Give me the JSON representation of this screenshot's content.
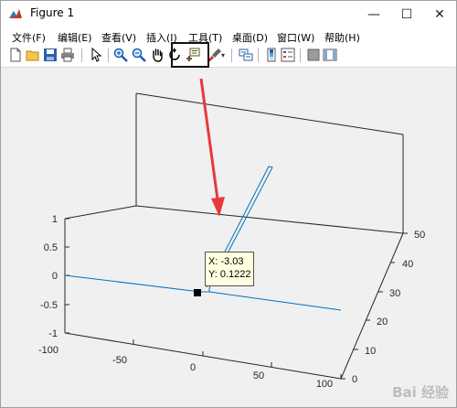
{
  "window": {
    "title": "Figure 1",
    "minimize": "—",
    "maximize": "☐",
    "close": "✕"
  },
  "menu": [
    "文件(F)",
    "编辑(E)",
    "查看(V)",
    "插入(I)",
    "工具(T)",
    "桌面(D)",
    "窗口(W)",
    "帮助(H)"
  ],
  "toolbar_icons": [
    "new-figure-icon",
    "open-file-icon",
    "save-icon",
    "print-icon",
    "select-arrow-icon",
    "zoom-in-icon",
    "zoom-out-icon",
    "pan-hand-icon",
    "rotate-3d-icon",
    "data-cursor-icon",
    "brush-icon",
    "link-plot-icon",
    "colorbar-icon",
    "legend-icon",
    "hide-plot-tools-icon",
    "show-plot-tools-icon"
  ],
  "axes": {
    "z_ticks": [
      "1",
      "0.5",
      "0",
      "-0.5",
      "-1"
    ],
    "x_ticks": [
      "-100",
      "-50",
      "0",
      "50",
      "100"
    ],
    "y_ticks": [
      "0",
      "10",
      "20",
      "30",
      "40",
      "50"
    ]
  },
  "datatip": {
    "x_line": "X: -3.03",
    "y_line": "Y: 0.1222"
  },
  "colors": {
    "line": "#0072bd",
    "annotation_arrow": "#e8393b",
    "highlight": "#111111"
  },
  "watermark": "Bai 经验"
}
